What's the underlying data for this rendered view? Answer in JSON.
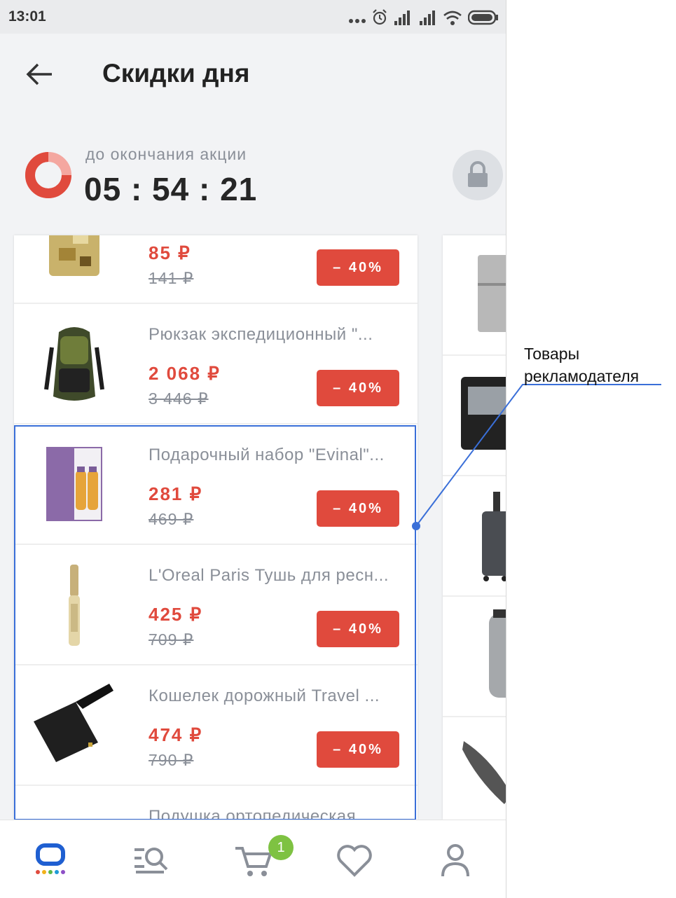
{
  "status_bar": {
    "time": "13:01"
  },
  "header": {
    "title": "Скидки дня"
  },
  "timer": {
    "label": "до окончания акции",
    "value": "05 : 54 : 21"
  },
  "products": [
    {
      "name": "",
      "price": "85 ₽",
      "old_price": "141 ₽",
      "discount": "– 40%"
    },
    {
      "name": "Рюкзак экспедиционный \"...",
      "price": "2 068 ₽",
      "old_price": "3 446 ₽",
      "discount": "– 40%"
    },
    {
      "name": "Подарочный набор \"Evinal\"...",
      "price": "281 ₽",
      "old_price": "469 ₽",
      "discount": "– 40%"
    },
    {
      "name": "L'Oreal Paris Тушь для ресн...",
      "price": "425 ₽",
      "old_price": "709 ₽",
      "discount": "– 40%"
    },
    {
      "name": "Кошелек дорожный Travel ...",
      "price": "474 ₽",
      "old_price": "790 ₽",
      "discount": "– 40%"
    },
    {
      "name": "Подушка ортопедическая"
    }
  ],
  "cart": {
    "count": "1"
  },
  "annotation": {
    "line1": "Товары",
    "line2": "рекламодателя"
  },
  "colors": {
    "accent_red": "#e04a3d",
    "highlight_blue": "#3a6fd8",
    "cart_badge_green": "#7ec242"
  }
}
